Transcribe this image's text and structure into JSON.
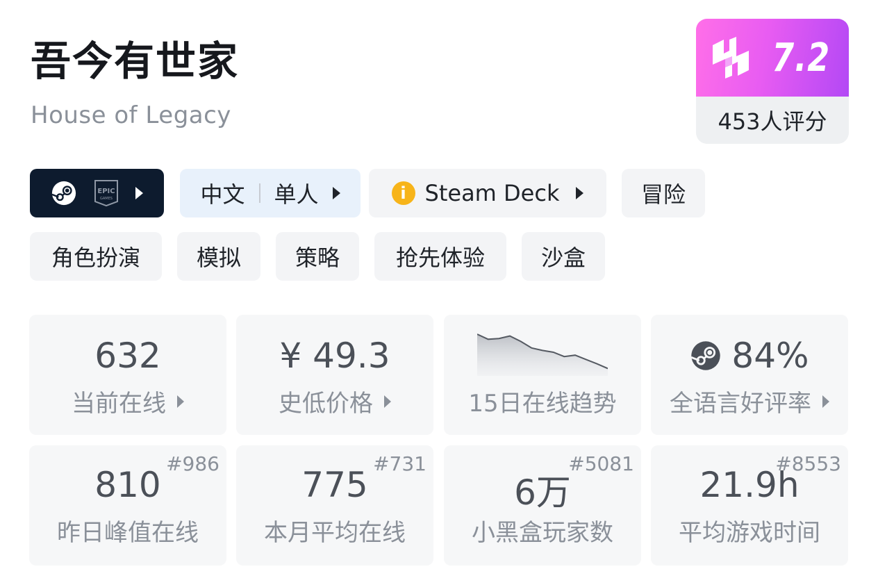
{
  "game": {
    "title": "吾今有世家",
    "subtitle": "House of Legacy"
  },
  "score": {
    "value": "7.2",
    "rating_count": "453人评分",
    "colors": {
      "gradient_start": "#ff6fe8",
      "gradient_end": "#b348f5"
    }
  },
  "tags_row1": {
    "platform": {
      "icons": [
        "steam-icon",
        "epic-games-icon"
      ]
    },
    "language": {
      "lang": "中文",
      "mode": "单人"
    },
    "deck": {
      "label": "Steam Deck",
      "status_icon": "info-icon"
    },
    "genre": "冒险"
  },
  "tags_row2": [
    "角色扮演",
    "模拟",
    "策略",
    "抢先体验",
    "沙盒"
  ],
  "stats_top": [
    {
      "value": "632",
      "label": "当前在线"
    },
    {
      "value": "¥ 49.3",
      "label": "史低价格"
    },
    {
      "label": "15日在线趋势",
      "trend": [
        1.0,
        0.86,
        0.88,
        0.95,
        0.8,
        0.62,
        0.55,
        0.5,
        0.38,
        0.42,
        0.3,
        0.18,
        0.05
      ]
    },
    {
      "value": "84%",
      "label": "全语言好评率"
    }
  ],
  "stats_bottom": [
    {
      "value": "810",
      "label": "昨日峰值在线",
      "rank": "#986"
    },
    {
      "value": "775",
      "label": "本月平均在线",
      "rank": "#731"
    },
    {
      "value": "6万",
      "label": "小黑盒玩家数",
      "rank": "#5081"
    },
    {
      "value": "21.9h",
      "label": "平均游戏时间",
      "rank": "#8553"
    }
  ]
}
